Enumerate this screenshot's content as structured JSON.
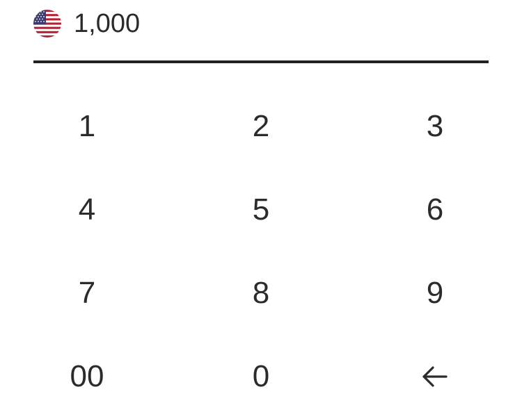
{
  "amount": {
    "currency_icon": "us-flag-icon",
    "value": "1,000"
  },
  "keypad": {
    "keys": [
      "1",
      "2",
      "3",
      "4",
      "5",
      "6",
      "7",
      "8",
      "9",
      "00",
      "0"
    ],
    "backspace_icon": "backspace-arrow-icon"
  },
  "colors": {
    "text": "#2b2b2b",
    "divider": "#222222",
    "flag_red": "#b22234",
    "flag_blue": "#3c3b6e"
  }
}
